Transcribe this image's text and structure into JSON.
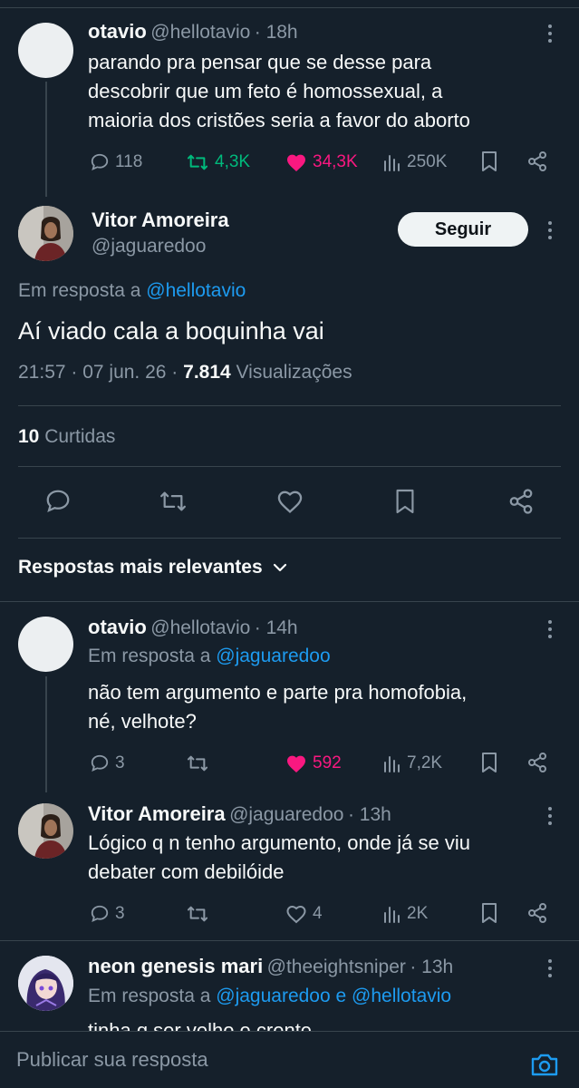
{
  "colors": {
    "background": "#15202b",
    "text": "#f7f9f9",
    "muted": "#8b98a5",
    "link": "#1d9bf0",
    "retweet_green": "#00ba7c",
    "like_pink": "#f91880"
  },
  "parent_tweet": {
    "name": "otavio",
    "handle": "@hellotavio",
    "time": "· 18h",
    "text_lines": [
      "parando pra pensar que se desse para",
      "descobrir que um feto é homossexual, a",
      "maioria dos cristões seria a favor do aborto"
    ],
    "replies": "118",
    "retweets": "4,3K",
    "likes": "34,3K",
    "views": "250K"
  },
  "main_tweet": {
    "name": "Vitor Amoreira",
    "handle": "@jaguaredoo",
    "follow_label": "Seguir",
    "reply_prefix": "Em resposta a",
    "reply_to": "@hellotavio",
    "text": "Aí viado cala a boquinha vai",
    "time": "21:57 · 07 jun. 26 ·",
    "views_count": "7.814",
    "views_label": "Visualizações",
    "likes_count": "10",
    "likes_label": "Curtidas"
  },
  "sort_label": "Respostas mais relevantes",
  "replies": [
    {
      "name": "otavio",
      "handle": "@hellotavio",
      "time": "· 14h",
      "reply_prefix": "Em resposta a",
      "reply_to": "@jaguaredoo",
      "text_lines": [
        "não tem argumento e parte pra homofobia,",
        "né, velhote?"
      ],
      "replies": "3",
      "retweets": "",
      "likes": "592",
      "views": "7,2K"
    },
    {
      "name": "Vitor Amoreira",
      "handle": "@jaguaredoo",
      "time": "· 13h",
      "text_lines": [
        "Lógico q n tenho argumento, onde já se viu",
        "debater com debilóide"
      ],
      "replies": "3",
      "retweets": "",
      "likes": "4",
      "views": "2K"
    },
    {
      "name": "neon genesis mari",
      "handle": "@theeightsniper",
      "time": "· 13h",
      "reply_prefix": "Em resposta a",
      "reply_to_1": "@jaguaredoo",
      "reply_and": "e",
      "reply_to_2": "@hellotavio",
      "text_partial": "tinha q ser velho e crente"
    }
  ],
  "composer": {
    "placeholder": "Publicar sua resposta",
    "camera_icon": "camera-icon"
  }
}
